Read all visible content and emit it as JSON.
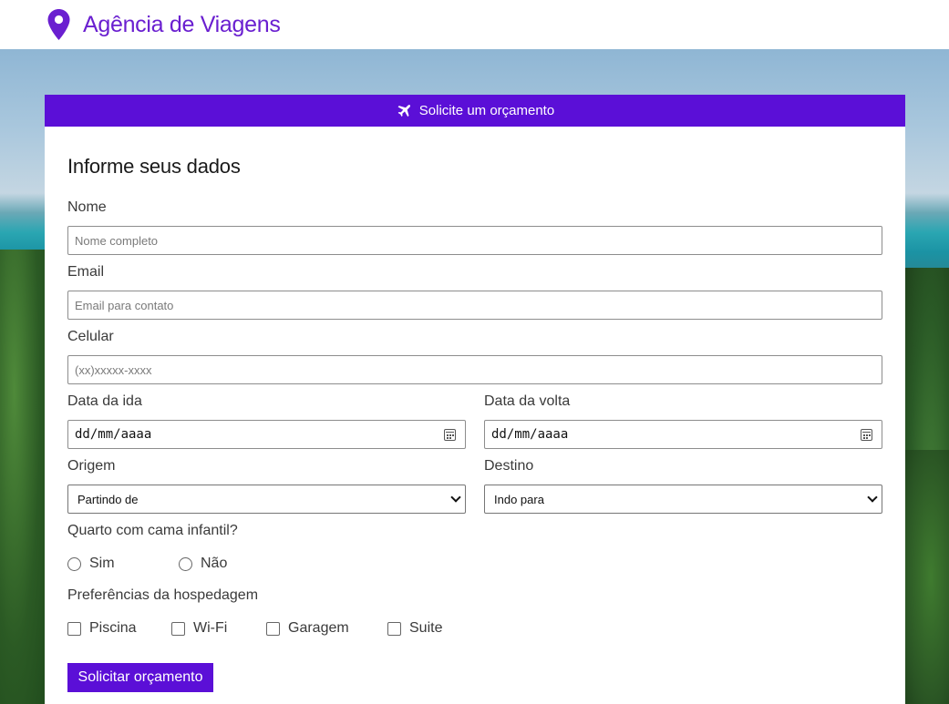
{
  "header": {
    "title": "Agência de Viagens",
    "icon": "map-pin-icon",
    "brand_color": "#6a1fd0"
  },
  "banner": {
    "label": "Solicite um orçamento",
    "icon": "airplane-icon",
    "color": "#5b0fd7"
  },
  "form": {
    "heading": "Informe seus dados",
    "nome": {
      "label": "Nome",
      "placeholder": "Nome completo"
    },
    "email": {
      "label": "Email",
      "placeholder": "Email para contato"
    },
    "celular": {
      "label": "Celular",
      "placeholder": "(xx)xxxxx-xxxx"
    },
    "ida": {
      "label": "Data da ida",
      "value": "dd/mm/aaaa"
    },
    "volta": {
      "label": "Data da volta",
      "value": "dd/mm/aaaa"
    },
    "origem": {
      "label": "Origem",
      "selected": "Partindo de"
    },
    "destino": {
      "label": "Destino",
      "selected": "Indo para"
    },
    "quarto": {
      "label": "Quarto com cama infantil?",
      "options": [
        "Sim",
        "Não"
      ]
    },
    "preferencias": {
      "label": "Preferências da hospedagem",
      "options": [
        "Piscina",
        "Wi-Fi",
        "Garagem",
        "Suite"
      ]
    },
    "submit_label": "Solicitar orçamento"
  }
}
